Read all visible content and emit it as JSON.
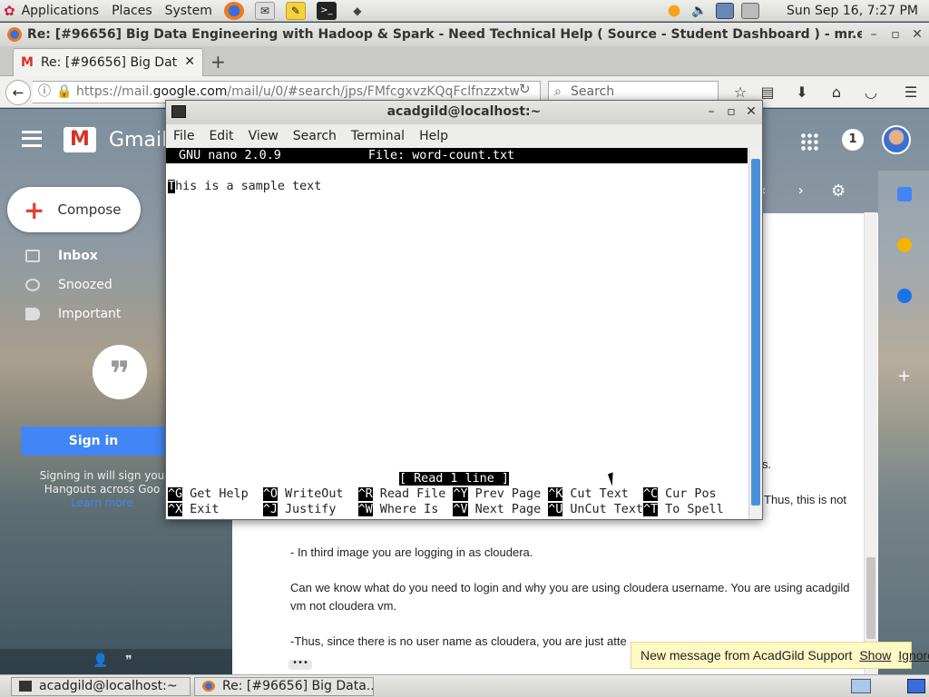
{
  "top_panel": {
    "menus": [
      "Applications",
      "Places",
      "System"
    ],
    "clock": "Sun Sep 16,  7:27 PM"
  },
  "firefox": {
    "window_title": "Re: [#96656] Big Data Engineering with Hadoop & Spark - Need Technical Help ( Source - Student Dashboard ) - mr.eroc",
    "tab_label": "Re: [#96656] Big Dat…",
    "url_prefix": "https://mail.",
    "url_domain": "google.com",
    "url_rest": "/mail/u/0/#search/jps/FMfcgxvzKQqFclfnzzxtw",
    "search_placeholder": "Search"
  },
  "gmail": {
    "brand": "Gmail",
    "notification_count": "1",
    "compose_label": "Compose",
    "nav": [
      "Inbox",
      "Snoozed",
      "Important"
    ],
    "signin_label": "Sign in",
    "signin_note": [
      "Signing in will sign you",
      "Hangouts across Goo",
      "Learn more"
    ],
    "body_lines": [
      "s.",
      "Thus, this is not",
      "- In third image you are logging in as cloudera.",
      "Can we know what do you need to login and why you are using cloudera username. You are using acadgild",
      "vm not cloudera vm.",
      "-Thus, since there is no user name as cloudera, you are just atte"
    ],
    "toast": {
      "text": "New message from AcadGild Support",
      "show": "Show",
      "ignore": "Ignore"
    }
  },
  "terminal": {
    "title": "acadgild@localhost:~",
    "menu": [
      "File",
      "Edit",
      "View",
      "Search",
      "Terminal",
      "Help"
    ],
    "nano_version": "GNU nano 2.0.9",
    "nano_file": "File: word-count.txt",
    "file_first_char": "T",
    "file_rest": "his is a sample text",
    "status": "[ Read 1 line ]",
    "shortcuts_row1": [
      {
        "key": "^G",
        "label": "Get Help"
      },
      {
        "key": "^O",
        "label": "WriteOut"
      },
      {
        "key": "^R",
        "label": "Read File"
      },
      {
        "key": "^Y",
        "label": "Prev Page"
      },
      {
        "key": "^K",
        "label": "Cut Text"
      },
      {
        "key": "^C",
        "label": "Cur Pos"
      }
    ],
    "shortcuts_row2": [
      {
        "key": "^X",
        "label": "Exit"
      },
      {
        "key": "^J",
        "label": "Justify"
      },
      {
        "key": "^W",
        "label": "Where Is"
      },
      {
        "key": "^V",
        "label": "Next Page"
      },
      {
        "key": "^U",
        "label": "UnCut Text"
      },
      {
        "key": "^T",
        "label": "To Spell"
      }
    ]
  },
  "taskbar": {
    "tasks": [
      "acadgild@localhost:~",
      "Re: [#96656] Big Data..."
    ]
  },
  "colors": {
    "gmail_red": "#d93025",
    "signin_blue": "#4285f4",
    "toast_bg": "#fff9c4",
    "terminal_scroll": "#4a90d9"
  }
}
